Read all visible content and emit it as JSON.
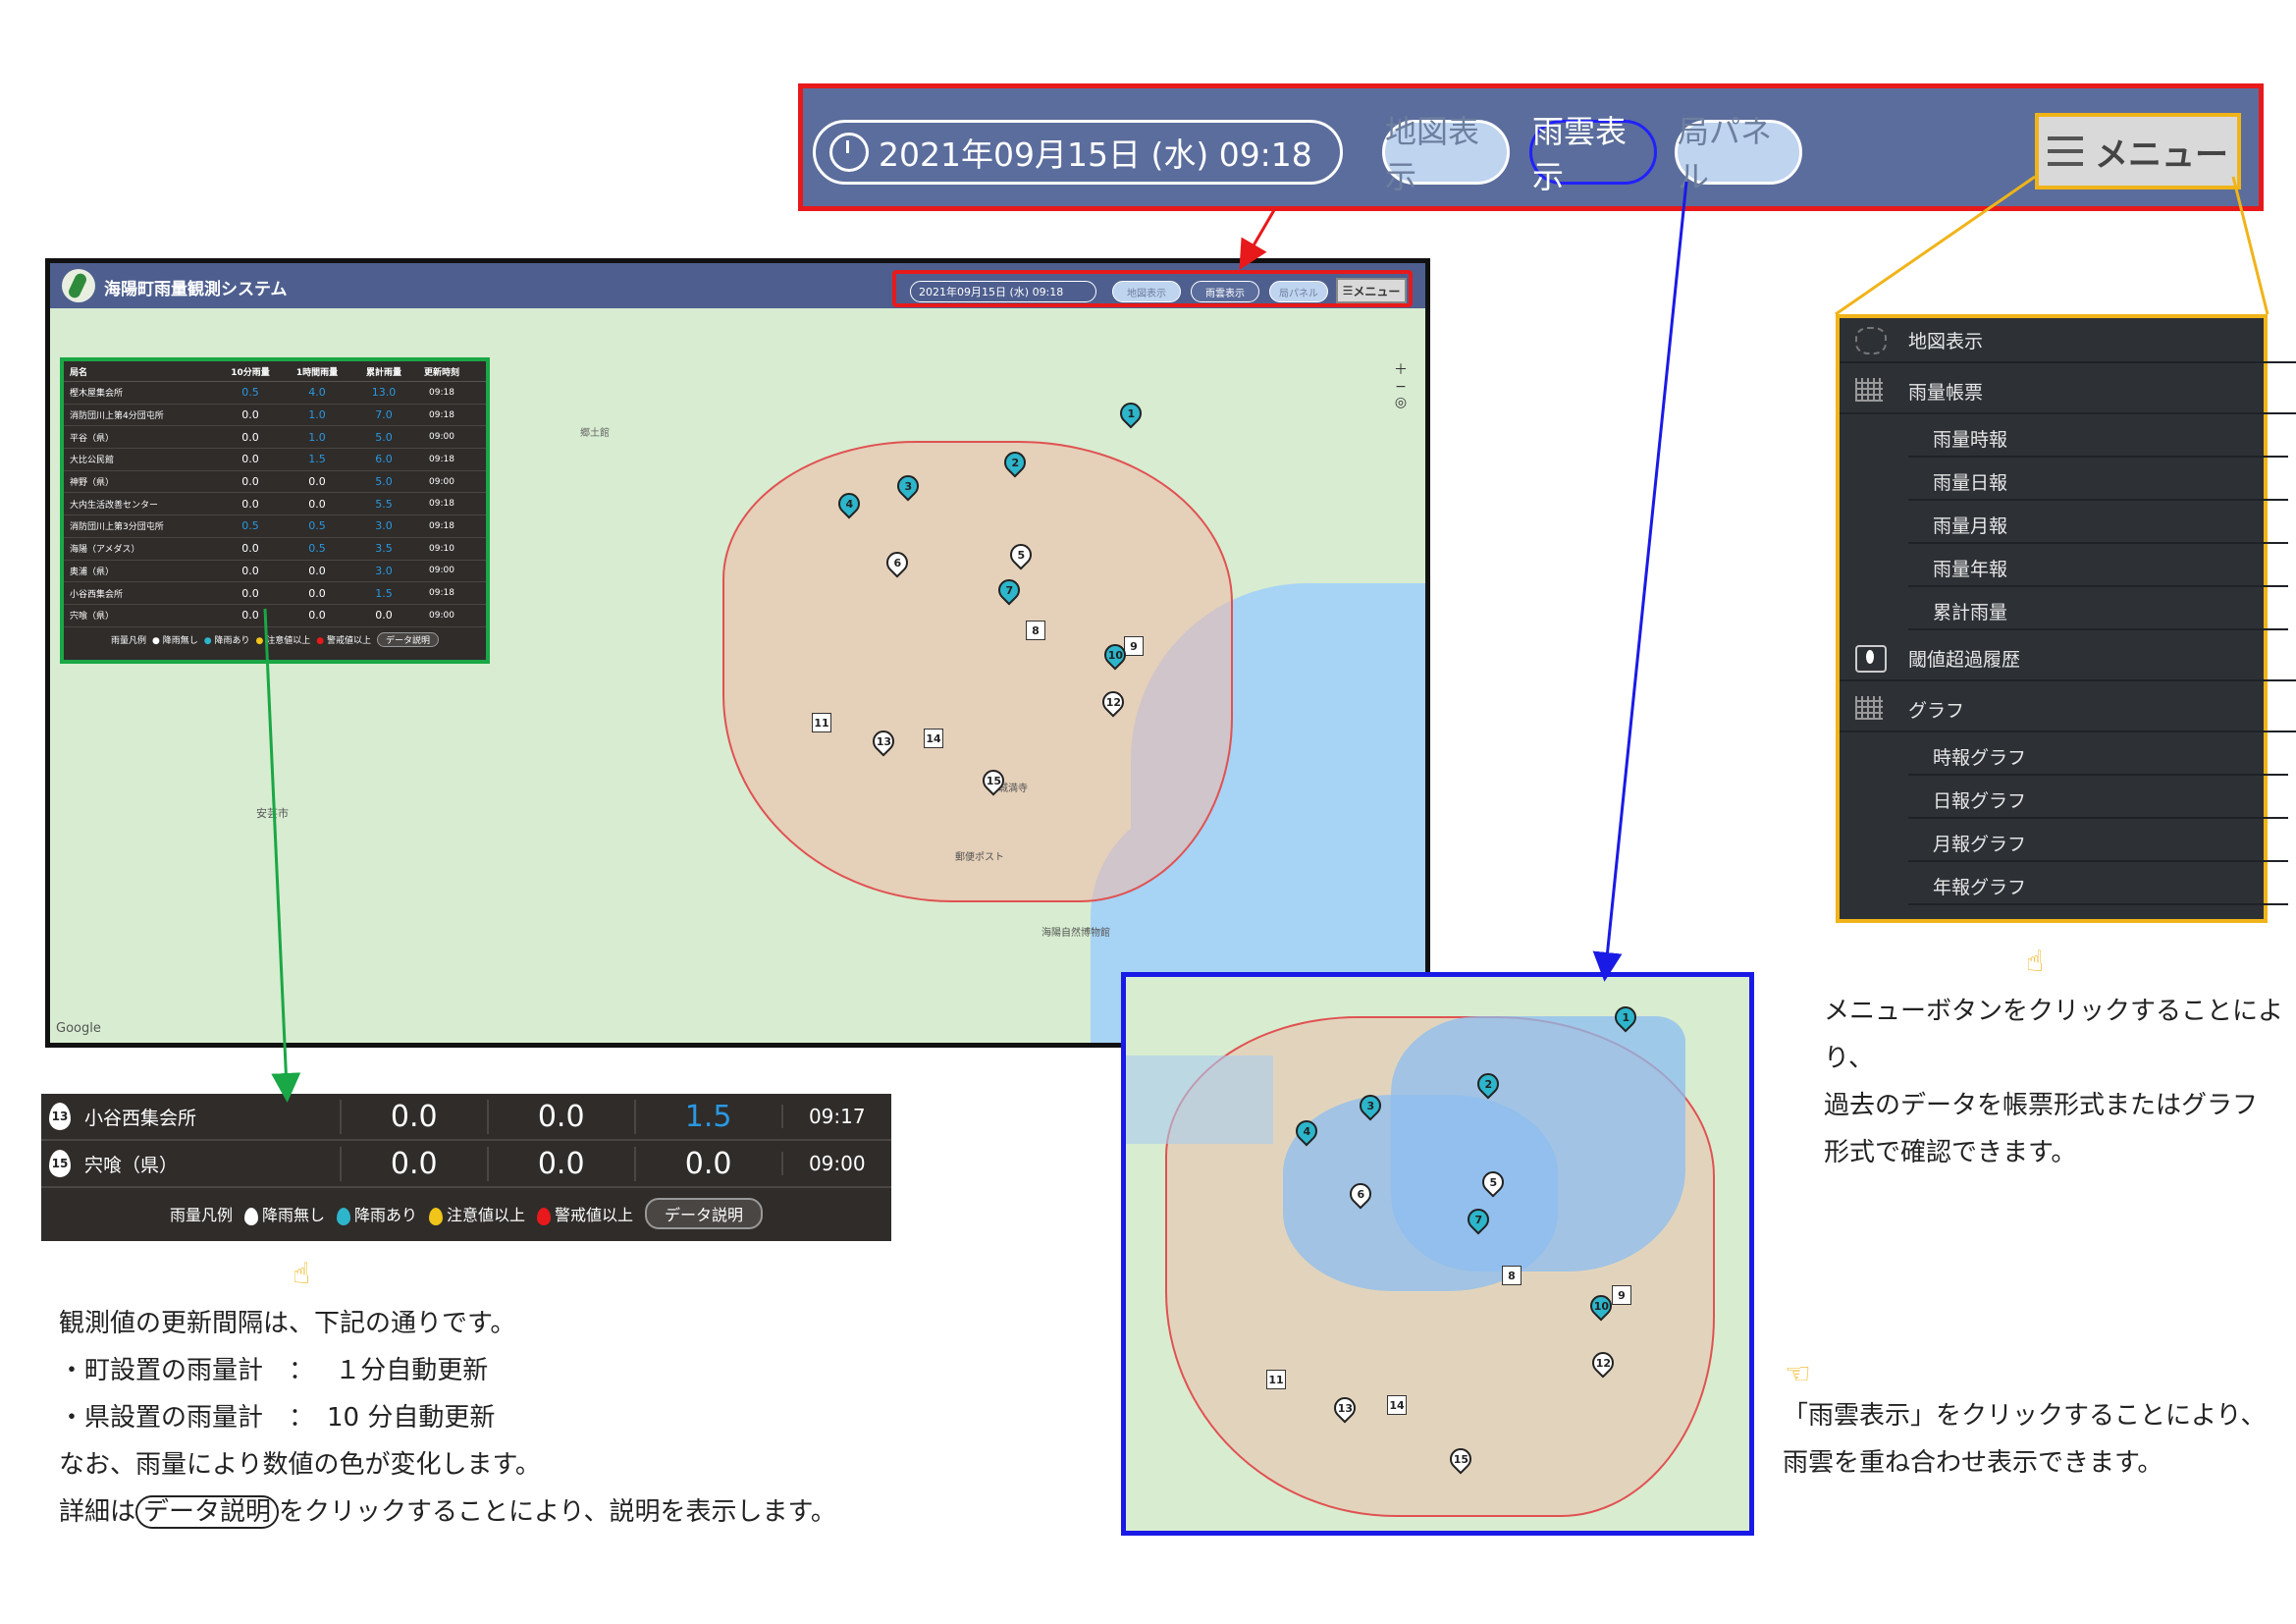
{
  "zoom_header": {
    "date": "2021年09月15日 (水) 09:18",
    "buttons": [
      "地図表示",
      "雨雲表示",
      "局パネル"
    ],
    "menu_label": "メニュー"
  },
  "app": {
    "title": "海陽町雨量観測システム",
    "date": "2021年09月15日 (水) 09:18",
    "buttons": [
      "地図表示",
      "雨雲表示",
      "局パネル"
    ],
    "menu_label": "メニュー"
  },
  "table": {
    "headers": [
      "局名",
      "10分雨量",
      "1時間雨量",
      "累計雨量",
      "更新時刻"
    ],
    "rows": [
      {
        "name": "樫木屋集会所",
        "v10": "0.5",
        "v60": "4.0",
        "sum": "13.0",
        "time": "09:18"
      },
      {
        "name": "消防団川上第4分団屯所",
        "v10": "0.0",
        "v60": "1.0",
        "sum": "7.0",
        "time": "09:18"
      },
      {
        "name": "平谷（県）",
        "v10": "0.0",
        "v60": "1.0",
        "sum": "5.0",
        "time": "09:00"
      },
      {
        "name": "大比公民館",
        "v10": "0.0",
        "v60": "1.5",
        "sum": "6.0",
        "time": "09:18"
      },
      {
        "name": "神野（県）",
        "v10": "0.0",
        "v60": "0.0",
        "sum": "5.0",
        "time": "09:00"
      },
      {
        "name": "大内生活改善センター",
        "v10": "0.0",
        "v60": "0.0",
        "sum": "5.5",
        "time": "09:18"
      },
      {
        "name": "消防団川上第3分団屯所",
        "v10": "0.5",
        "v60": "0.5",
        "sum": "3.0",
        "time": "09:18"
      },
      {
        "name": "海陽（アメダス）",
        "v10": "0.0",
        "v60": "0.5",
        "sum": "3.5",
        "time": "09:10"
      },
      {
        "name": "奥浦（県）",
        "v10": "0.0",
        "v60": "0.0",
        "sum": "3.0",
        "time": "09:00"
      },
      {
        "name": "小谷西集会所",
        "v10": "0.0",
        "v60": "0.0",
        "sum": "1.5",
        "time": "09:18"
      },
      {
        "name": "宍喰（県）",
        "v10": "0.0",
        "v60": "0.0",
        "sum": "0.0",
        "time": "09:00"
      }
    ],
    "legend": {
      "title": "雨量凡例",
      "items": [
        "降雨無し",
        "降雨あり",
        "注意値以上",
        "警戒値以上"
      ],
      "button": "データ説明"
    }
  },
  "menu_panel": {
    "items": [
      {
        "label": "地図表示",
        "level": "top",
        "icon": "map-icon"
      },
      {
        "label": "雨量帳票",
        "level": "top",
        "icon": "grid-icon"
      },
      {
        "label": "雨量時報",
        "level": "sub"
      },
      {
        "label": "雨量日報",
        "level": "sub"
      },
      {
        "label": "雨量月報",
        "level": "sub"
      },
      {
        "label": "雨量年報",
        "level": "sub"
      },
      {
        "label": "累計雨量",
        "level": "sub"
      },
      {
        "label": "閾値超過履歴",
        "level": "top",
        "icon": "alert-icon"
      },
      {
        "label": "グラフ",
        "level": "top",
        "icon": "grid-icon"
      },
      {
        "label": "時報グラフ",
        "level": "sub"
      },
      {
        "label": "日報グラフ",
        "level": "sub"
      },
      {
        "label": "月報グラフ",
        "level": "sub"
      },
      {
        "label": "年報グラフ",
        "level": "sub"
      }
    ]
  },
  "zoom_table": {
    "rows": [
      {
        "id": "13",
        "name": "小谷西集会所",
        "v10": "0.0",
        "v60": "0.0",
        "sum": "1.5",
        "time": "09:17"
      },
      {
        "id": "15",
        "name": "宍喰（県）",
        "v10": "0.0",
        "v60": "0.0",
        "sum": "0.0",
        "time": "09:00"
      }
    ],
    "legend_title": "雨量凡例",
    "legend_items": [
      "降雨無し",
      "降雨あり",
      "注意値以上",
      "警戒値以上"
    ],
    "button": "データ説明"
  },
  "notes": {
    "menu": [
      "メニューボタンをクリックすることにより、",
      "過去のデータを帳票形式またはグラフ",
      "形式で確認できます。"
    ],
    "cloud": [
      "「雨雲表示」をクリックすることにより、",
      "雨雲を重ね合わせ表示できます。"
    ],
    "update_1": "観測値の更新間隔は、下記の通りです。",
    "update_2": "・町設置の雨量計　：　 １分自動更新",
    "update_3": "・県設置の雨量計　：　10 分自動更新",
    "update_4": "なお、雨量により数値の色が変化します。",
    "update_5a": "詳細は",
    "update_5b": "データ説明",
    "update_5c": "をクリックすることにより、説明を表示します。"
  },
  "map_labels": {
    "place_1": "郷土館",
    "place_2": "安芸市",
    "place_3": "海陽自然博物館",
    "place_4": "城満寺",
    "place_5": "郵便ポスト",
    "place_6": "Google"
  },
  "colors": {
    "header_bg": "#5b6d9c",
    "highlight_red": "#e8191b",
    "highlight_blue": "#1a1ae6",
    "highlight_yellow": "#f0b419",
    "highlight_green": "#1aa745",
    "rain_blue": "#2a98e0"
  }
}
